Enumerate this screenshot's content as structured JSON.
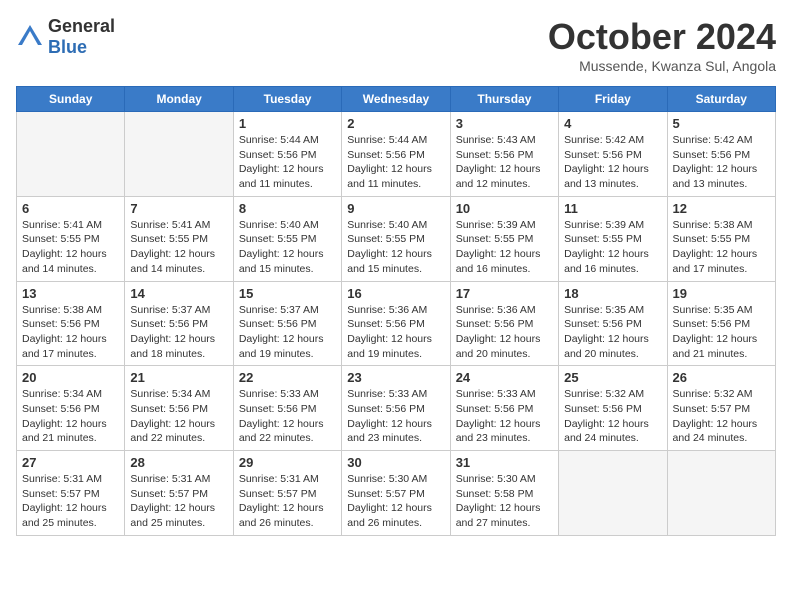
{
  "logo": {
    "general": "General",
    "blue": "Blue"
  },
  "header": {
    "month": "October 2024",
    "location": "Mussende, Kwanza Sul, Angola"
  },
  "weekdays": [
    "Sunday",
    "Monday",
    "Tuesday",
    "Wednesday",
    "Thursday",
    "Friday",
    "Saturday"
  ],
  "weeks": [
    [
      {
        "day": "",
        "empty": true
      },
      {
        "day": "",
        "empty": true
      },
      {
        "day": "1",
        "sunrise": "Sunrise: 5:44 AM",
        "sunset": "Sunset: 5:56 PM",
        "daylight": "Daylight: 12 hours and 11 minutes."
      },
      {
        "day": "2",
        "sunrise": "Sunrise: 5:44 AM",
        "sunset": "Sunset: 5:56 PM",
        "daylight": "Daylight: 12 hours and 11 minutes."
      },
      {
        "day": "3",
        "sunrise": "Sunrise: 5:43 AM",
        "sunset": "Sunset: 5:56 PM",
        "daylight": "Daylight: 12 hours and 12 minutes."
      },
      {
        "day": "4",
        "sunrise": "Sunrise: 5:42 AM",
        "sunset": "Sunset: 5:56 PM",
        "daylight": "Daylight: 12 hours and 13 minutes."
      },
      {
        "day": "5",
        "sunrise": "Sunrise: 5:42 AM",
        "sunset": "Sunset: 5:56 PM",
        "daylight": "Daylight: 12 hours and 13 minutes."
      }
    ],
    [
      {
        "day": "6",
        "sunrise": "Sunrise: 5:41 AM",
        "sunset": "Sunset: 5:55 PM",
        "daylight": "Daylight: 12 hours and 14 minutes."
      },
      {
        "day": "7",
        "sunrise": "Sunrise: 5:41 AM",
        "sunset": "Sunset: 5:55 PM",
        "daylight": "Daylight: 12 hours and 14 minutes."
      },
      {
        "day": "8",
        "sunrise": "Sunrise: 5:40 AM",
        "sunset": "Sunset: 5:55 PM",
        "daylight": "Daylight: 12 hours and 15 minutes."
      },
      {
        "day": "9",
        "sunrise": "Sunrise: 5:40 AM",
        "sunset": "Sunset: 5:55 PM",
        "daylight": "Daylight: 12 hours and 15 minutes."
      },
      {
        "day": "10",
        "sunrise": "Sunrise: 5:39 AM",
        "sunset": "Sunset: 5:55 PM",
        "daylight": "Daylight: 12 hours and 16 minutes."
      },
      {
        "day": "11",
        "sunrise": "Sunrise: 5:39 AM",
        "sunset": "Sunset: 5:55 PM",
        "daylight": "Daylight: 12 hours and 16 minutes."
      },
      {
        "day": "12",
        "sunrise": "Sunrise: 5:38 AM",
        "sunset": "Sunset: 5:55 PM",
        "daylight": "Daylight: 12 hours and 17 minutes."
      }
    ],
    [
      {
        "day": "13",
        "sunrise": "Sunrise: 5:38 AM",
        "sunset": "Sunset: 5:56 PM",
        "daylight": "Daylight: 12 hours and 17 minutes."
      },
      {
        "day": "14",
        "sunrise": "Sunrise: 5:37 AM",
        "sunset": "Sunset: 5:56 PM",
        "daylight": "Daylight: 12 hours and 18 minutes."
      },
      {
        "day": "15",
        "sunrise": "Sunrise: 5:37 AM",
        "sunset": "Sunset: 5:56 PM",
        "daylight": "Daylight: 12 hours and 19 minutes."
      },
      {
        "day": "16",
        "sunrise": "Sunrise: 5:36 AM",
        "sunset": "Sunset: 5:56 PM",
        "daylight": "Daylight: 12 hours and 19 minutes."
      },
      {
        "day": "17",
        "sunrise": "Sunrise: 5:36 AM",
        "sunset": "Sunset: 5:56 PM",
        "daylight": "Daylight: 12 hours and 20 minutes."
      },
      {
        "day": "18",
        "sunrise": "Sunrise: 5:35 AM",
        "sunset": "Sunset: 5:56 PM",
        "daylight": "Daylight: 12 hours and 20 minutes."
      },
      {
        "day": "19",
        "sunrise": "Sunrise: 5:35 AM",
        "sunset": "Sunset: 5:56 PM",
        "daylight": "Daylight: 12 hours and 21 minutes."
      }
    ],
    [
      {
        "day": "20",
        "sunrise": "Sunrise: 5:34 AM",
        "sunset": "Sunset: 5:56 PM",
        "daylight": "Daylight: 12 hours and 21 minutes."
      },
      {
        "day": "21",
        "sunrise": "Sunrise: 5:34 AM",
        "sunset": "Sunset: 5:56 PM",
        "daylight": "Daylight: 12 hours and 22 minutes."
      },
      {
        "day": "22",
        "sunrise": "Sunrise: 5:33 AM",
        "sunset": "Sunset: 5:56 PM",
        "daylight": "Daylight: 12 hours and 22 minutes."
      },
      {
        "day": "23",
        "sunrise": "Sunrise: 5:33 AM",
        "sunset": "Sunset: 5:56 PM",
        "daylight": "Daylight: 12 hours and 23 minutes."
      },
      {
        "day": "24",
        "sunrise": "Sunrise: 5:33 AM",
        "sunset": "Sunset: 5:56 PM",
        "daylight": "Daylight: 12 hours and 23 minutes."
      },
      {
        "day": "25",
        "sunrise": "Sunrise: 5:32 AM",
        "sunset": "Sunset: 5:56 PM",
        "daylight": "Daylight: 12 hours and 24 minutes."
      },
      {
        "day": "26",
        "sunrise": "Sunrise: 5:32 AM",
        "sunset": "Sunset: 5:57 PM",
        "daylight": "Daylight: 12 hours and 24 minutes."
      }
    ],
    [
      {
        "day": "27",
        "sunrise": "Sunrise: 5:31 AM",
        "sunset": "Sunset: 5:57 PM",
        "daylight": "Daylight: 12 hours and 25 minutes."
      },
      {
        "day": "28",
        "sunrise": "Sunrise: 5:31 AM",
        "sunset": "Sunset: 5:57 PM",
        "daylight": "Daylight: 12 hours and 25 minutes."
      },
      {
        "day": "29",
        "sunrise": "Sunrise: 5:31 AM",
        "sunset": "Sunset: 5:57 PM",
        "daylight": "Daylight: 12 hours and 26 minutes."
      },
      {
        "day": "30",
        "sunrise": "Sunrise: 5:30 AM",
        "sunset": "Sunset: 5:57 PM",
        "daylight": "Daylight: 12 hours and 26 minutes."
      },
      {
        "day": "31",
        "sunrise": "Sunrise: 5:30 AM",
        "sunset": "Sunset: 5:58 PM",
        "daylight": "Daylight: 12 hours and 27 minutes."
      },
      {
        "day": "",
        "empty": true
      },
      {
        "day": "",
        "empty": true
      }
    ]
  ]
}
